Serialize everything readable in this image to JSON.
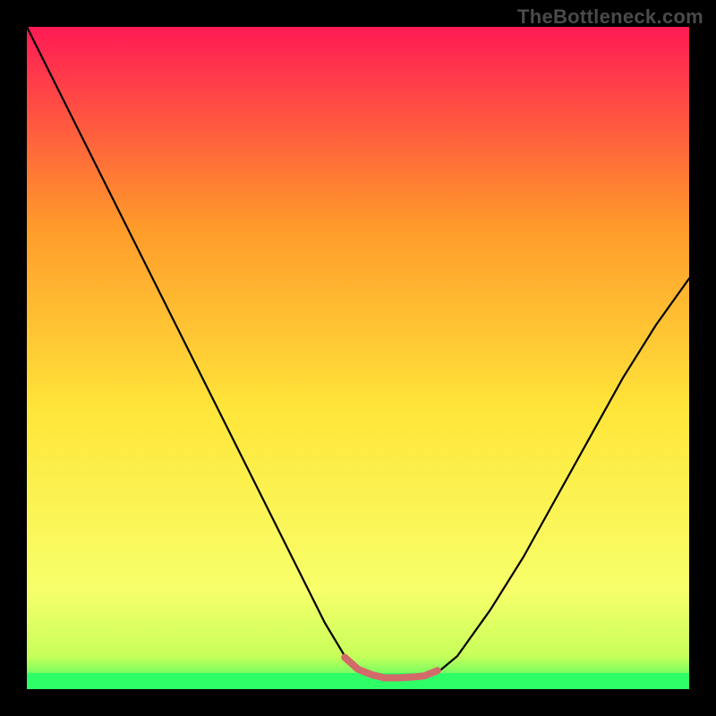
{
  "watermark": "TheBottleneck.com",
  "chart_data": {
    "type": "line",
    "title": "",
    "xlabel": "",
    "ylabel": "",
    "xlim": [
      0,
      100
    ],
    "ylim": [
      0,
      100
    ],
    "background_gradient": {
      "top": "#ff1a55",
      "upper_mid": "#ff9a2a",
      "mid": "#ffe63a",
      "lower_mid": "#f7ff6a",
      "bottom_band": "#2eff66"
    },
    "series": [
      {
        "name": "curve",
        "color": "#000000",
        "x": [
          0,
          5,
          10,
          15,
          20,
          25,
          30,
          35,
          40,
          45,
          48,
          50,
          52,
          54,
          56,
          58,
          60,
          62,
          65,
          70,
          75,
          80,
          85,
          90,
          95,
          100
        ],
        "y": [
          100,
          90,
          80,
          70,
          60,
          50,
          40,
          30,
          20,
          10,
          5,
          3,
          2,
          1.5,
          1.5,
          1.5,
          1.7,
          2.5,
          5,
          12,
          20,
          29,
          38,
          47,
          55,
          62
        ]
      },
      {
        "name": "highlight",
        "color": "#d36a6a",
        "x": [
          48,
          50,
          52,
          54,
          56,
          58,
          60,
          62
        ],
        "y": [
          4.8,
          3,
          2.2,
          1.7,
          1.7,
          1.8,
          2.0,
          2.8
        ]
      }
    ]
  }
}
